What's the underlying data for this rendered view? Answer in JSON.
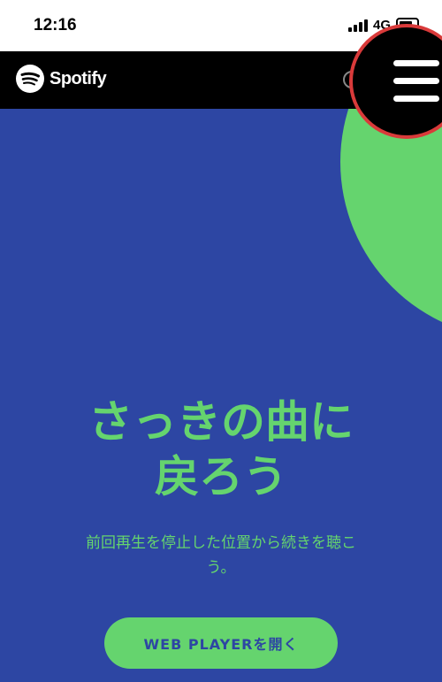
{
  "status_bar": {
    "time": "12:16",
    "network": "4G"
  },
  "navbar": {
    "brand": "Spotify",
    "icons": [
      "spotify-logo-icon",
      "user-icon",
      "menu-icon"
    ]
  },
  "hero": {
    "title_line1": "さっきの曲に",
    "title_line2": "戻ろう",
    "subtitle_line1": "前回再生を停止した位置から続きを聴こ",
    "subtitle_line2": "う。",
    "cta_label": "WEB PLAYERを開く"
  },
  "colors": {
    "background": "#2d46a3",
    "accent": "#65d46e",
    "navbar": "#000000",
    "highlight_ring": "#d93a3a"
  }
}
